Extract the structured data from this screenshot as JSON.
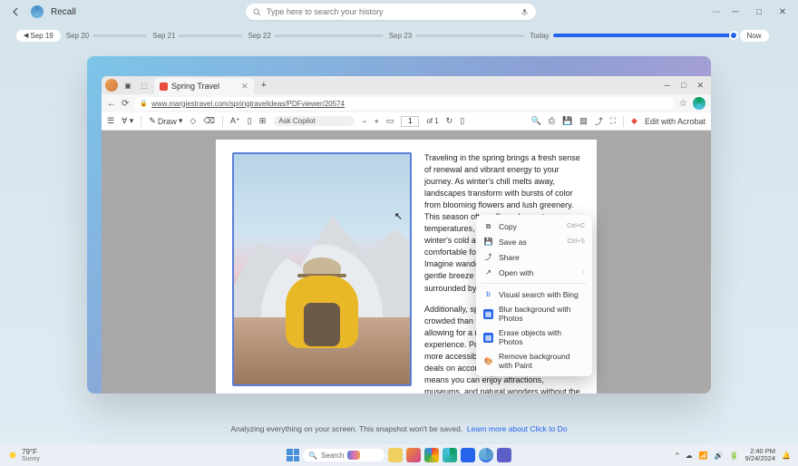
{
  "recall": {
    "app_title": "Recall",
    "search_placeholder": "Type here to search your history"
  },
  "timeline": {
    "back_label": "Sep 19",
    "dates": [
      "Sep 20",
      "Sep 21",
      "Sep 22",
      "Sep 23"
    ],
    "today_label": "Today",
    "now_label": "Now"
  },
  "browser": {
    "tab_title": "Spring Travel",
    "url": "www.margiestravel.com/springtravelideas/PDFviewer/20574"
  },
  "pdf_toolbar": {
    "draw": "Draw",
    "ask_copilot": "Ask Copilot",
    "page_current": "1",
    "page_of": "of 1",
    "edit": "Edit with Acrobat"
  },
  "pdf_text": {
    "p1": "Traveling in the spring brings a fresh sense of renewal and vibrant energy to your journey. As winter's chill melts away, landscapes transform with bursts of color from blooming flowers and lush greenery. This season often offers pleasant temperatures, avoiding the extremes of winter's cold and summer's heat, making it comfortable for outdoor explorations. Imagine wandering through gardens with a gentle breeze at your back, sipping coffee surrounded by nature's",
    "p2": "Additionally, spring tends to be less crowded than the peak summer months, allowing for a more relaxed and intimate experience. Popular tourist spots become more accessible, and you might find better deals on accommodations and flights. This means you can enjoy attractions, museums, and natural wonders without the overwhelming hustle and bustle. There's also something particularly enchanting about local festivals and events celebrating the arrival of spring, which provide a deeper connection to the culture and traditions of the place you're visiting."
  },
  "context_menu": {
    "copy": "Copy",
    "copy_shortcut": "Ctrl+C",
    "save_as": "Save as",
    "save_shortcut": "Ctrl+S",
    "share": "Share",
    "open_with": "Open with",
    "visual_search": "Visual search with Bing",
    "blur_bg": "Blur background with Photos",
    "erase_objects": "Erase objects with Photos",
    "remove_bg": "Remove background with Paint"
  },
  "footer": {
    "text": "Analyzing everything on your screen. This snapshot won't be saved.",
    "link": "Learn more about Click to Do"
  },
  "taskbar": {
    "temp": "79°F",
    "condition": "Sunny",
    "search": "Search",
    "time": "2:40 PM",
    "date": "9/24/2024"
  }
}
